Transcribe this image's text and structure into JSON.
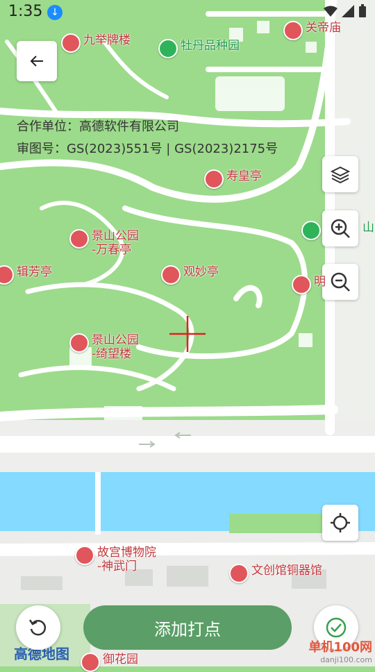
{
  "status": {
    "time": "1:35"
  },
  "copyright": {
    "partner": "合作单位：高德软件有限公司",
    "review": "审图号：GS(2023)551号 | GS(2023)2175号"
  },
  "pois": [
    {
      "id": "jiujupailou",
      "label": "九举牌楼",
      "color": "red"
    },
    {
      "id": "mudanpinzhongyuan",
      "label": "牡丹品种园",
      "color": "green"
    },
    {
      "id": "guandimiao",
      "label": "关帝庙",
      "color": "red"
    },
    {
      "id": "shouhuangting",
      "label": "寿皇亭",
      "color": "red"
    },
    {
      "id": "wanchunting",
      "label": "景山公园\n-万春亭",
      "color": "red"
    },
    {
      "id": "jifangting",
      "label": "辑芳亭",
      "color": "red"
    },
    {
      "id": "guanmiaoting",
      "label": "观妙亭",
      "color": "red"
    },
    {
      "id": "ming",
      "label": "明",
      "color": "red"
    },
    {
      "id": "jingshan",
      "label": "山",
      "color": "green"
    },
    {
      "id": "qiwanglou",
      "label": "景山公园\n-绮望楼",
      "color": "red"
    },
    {
      "id": "shenwumen",
      "label": "故宫博物院\n-神武门",
      "color": "red"
    },
    {
      "id": "wenchuangguan",
      "label": "文创馆铜器馆",
      "color": "red"
    },
    {
      "id": "yuhuayuan",
      "label": "御花园",
      "color": "red"
    }
  ],
  "buttons": {
    "add_point": "添加打点"
  },
  "map_logo": "高德地图",
  "watermark": {
    "line1": "单机100网",
    "line2": "danji100.com"
  },
  "colors": {
    "park": "#9cdb8b",
    "road": "#ffffff",
    "water": "#84dbff",
    "primary": "#5b9e67"
  }
}
